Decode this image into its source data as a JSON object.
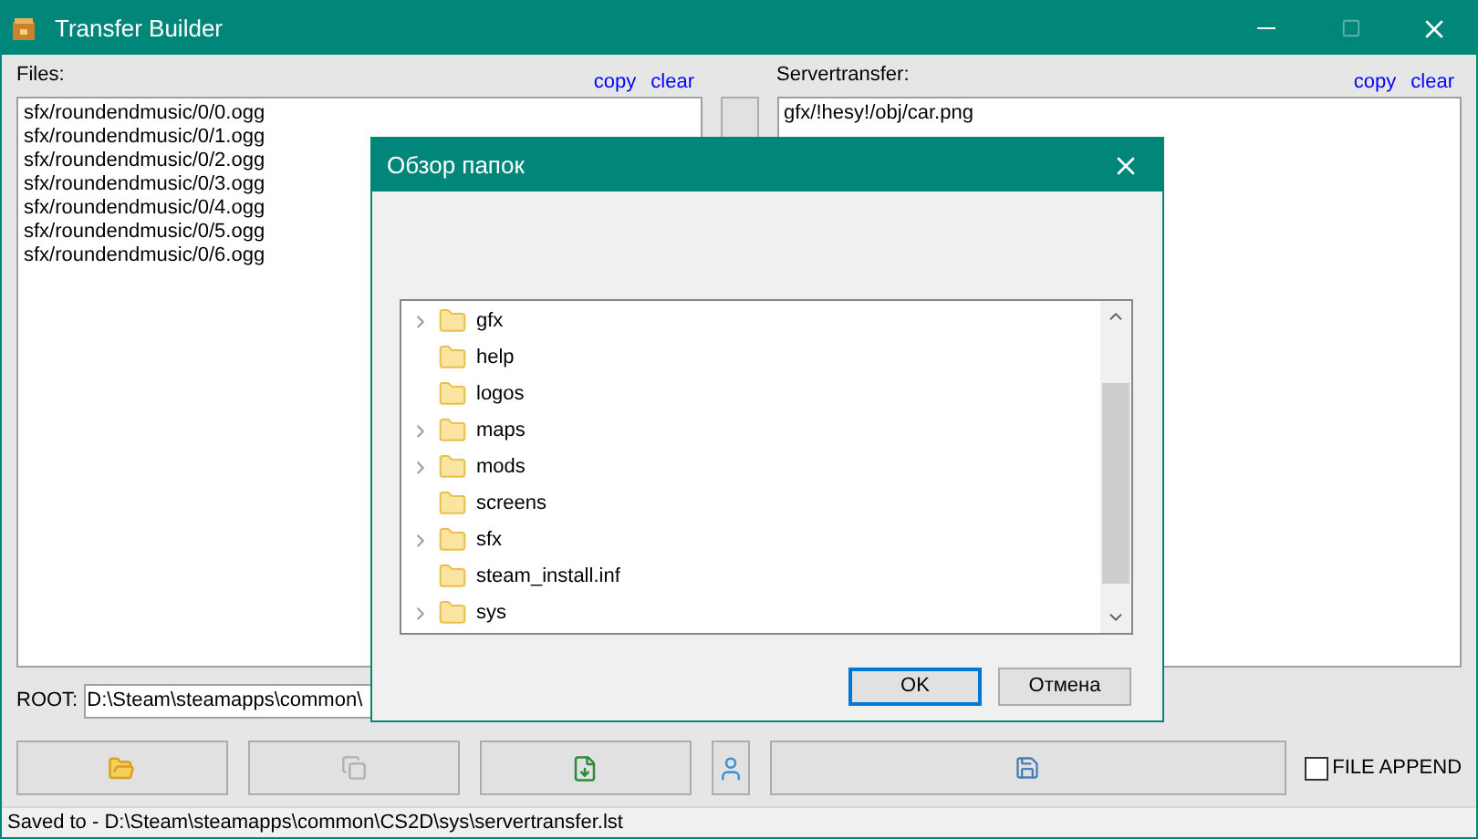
{
  "window": {
    "title": "Transfer Builder"
  },
  "files": {
    "label": "Files:",
    "links": [
      "copy",
      "clear"
    ],
    "items": [
      "sfx/roundendmusic/0/0.ogg",
      "sfx/roundendmusic/0/1.ogg",
      "sfx/roundendmusic/0/2.ogg",
      "sfx/roundendmusic/0/3.ogg",
      "sfx/roundendmusic/0/4.ogg",
      "sfx/roundendmusic/0/5.ogg",
      "sfx/roundendmusic/0/6.ogg"
    ]
  },
  "servertransfer": {
    "label": "Servertransfer:",
    "links": [
      "copy",
      "clear"
    ],
    "items": [
      "gfx/!hesy!/obj/car.png"
    ]
  },
  "root": {
    "label": "ROOT:",
    "value": "D:\\Steam\\steamapps\\common\\"
  },
  "file_append": {
    "label": "FILE APPEND",
    "checked": false
  },
  "status_bar": "Saved to - D:\\Steam\\steamapps\\common\\CS2D\\sys\\servertransfer.lst",
  "dialog": {
    "title": "Обзор папок",
    "tree": [
      {
        "label": "gfx",
        "expandable": true
      },
      {
        "label": "help",
        "expandable": false
      },
      {
        "label": "logos",
        "expandable": false
      },
      {
        "label": "maps",
        "expandable": true
      },
      {
        "label": "mods",
        "expandable": true
      },
      {
        "label": "screens",
        "expandable": false
      },
      {
        "label": "sfx",
        "expandable": true
      },
      {
        "label": "steam_install.inf",
        "expandable": false
      },
      {
        "label": "sys",
        "expandable": true
      }
    ],
    "buttons": [
      "OK",
      "Отмена"
    ]
  }
}
